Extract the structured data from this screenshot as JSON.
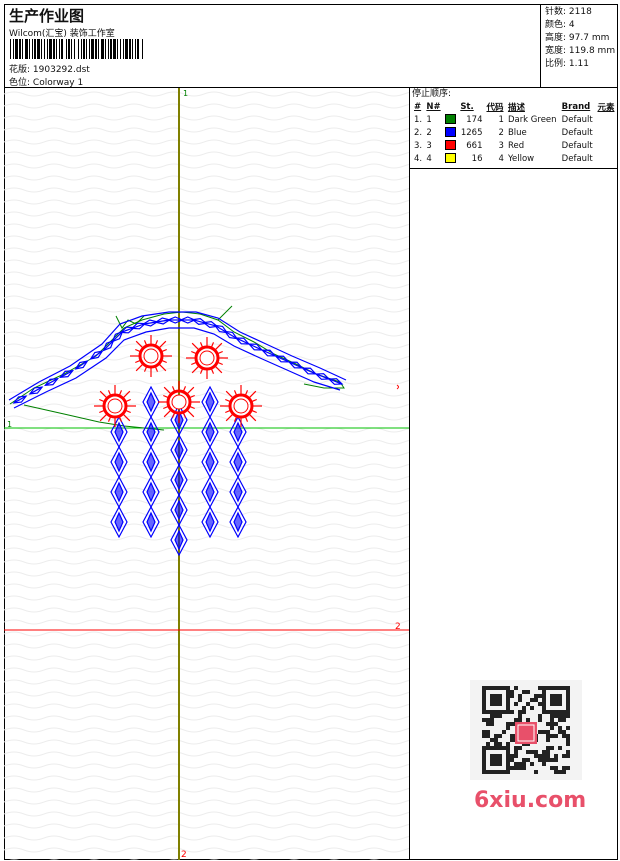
{
  "header": {
    "title": "生产作业图",
    "company": "Wilcom(汇宝) 装饰工作室",
    "design_label": "花版:",
    "design_value": "1903292.dst",
    "colorway_label": "色位:",
    "colorway_value": "Colorway 1"
  },
  "stats": [
    {
      "label": "针数:",
      "value": "2118"
    },
    {
      "label": "颜色:",
      "value": "4"
    },
    {
      "label": "高度:",
      "value": "97.7 mm"
    },
    {
      "label": "宽度:",
      "value": "119.8 mm"
    },
    {
      "label": "比例:",
      "value": "1.11"
    }
  ],
  "stop_sequence": {
    "title": "停止顺序:",
    "columns": [
      "#",
      "N#",
      "St.",
      "代码",
      "描述",
      "Brand",
      "元素"
    ],
    "rows": [
      {
        "index": "1.",
        "n": "1",
        "color": "#008000",
        "stitches": "174",
        "code": "1",
        "description": "Dark Green",
        "brand": "Default"
      },
      {
        "index": "2.",
        "n": "2",
        "color": "#0000ff",
        "stitches": "1265",
        "code": "2",
        "description": "Blue",
        "brand": "Default"
      },
      {
        "index": "3.",
        "n": "3",
        "color": "#ff0000",
        "stitches": "661",
        "code": "3",
        "description": "Red",
        "brand": "Default"
      },
      {
        "index": "4.",
        "n": "4",
        "color": "#ffff00",
        "stitches": "16",
        "code": "4",
        "description": "Yellow",
        "brand": "Default"
      }
    ]
  },
  "guides": {
    "vertical_top_label": "1",
    "vertical_bottom_label": "2",
    "horizontal_green_label": "1",
    "horizontal_red_label": "2"
  },
  "colors": {
    "green": "#008000",
    "blue": "#0000ff",
    "red": "#ff0000",
    "olive": "#808000",
    "guide_green": "#00c000",
    "guide_red": "#ff0000"
  },
  "watermark": "6xiu.com"
}
